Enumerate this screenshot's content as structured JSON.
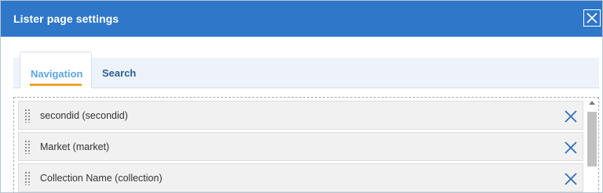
{
  "dialog": {
    "title": "Lister page settings",
    "close_icon": "close-icon"
  },
  "tabs": [
    {
      "label": "Navigation",
      "active": true
    },
    {
      "label": "Search",
      "active": false
    }
  ],
  "list": {
    "items": [
      {
        "label": "secondid (secondid)",
        "drag_icon": "drag-handle-icon",
        "remove_icon": "remove-icon"
      },
      {
        "label": "Market (market)",
        "drag_icon": "drag-handle-icon",
        "remove_icon": "remove-icon"
      },
      {
        "label": "Collection Name (collection)",
        "drag_icon": "drag-handle-icon",
        "remove_icon": "remove-icon"
      }
    ]
  },
  "colors": {
    "titlebar": "#2f77c9",
    "active_tab_text": "#5aa6e3",
    "inactive_tab_text": "#2a5f98",
    "tab_underline": "#f1a02a",
    "remove_icon": "#2f6fb5"
  }
}
